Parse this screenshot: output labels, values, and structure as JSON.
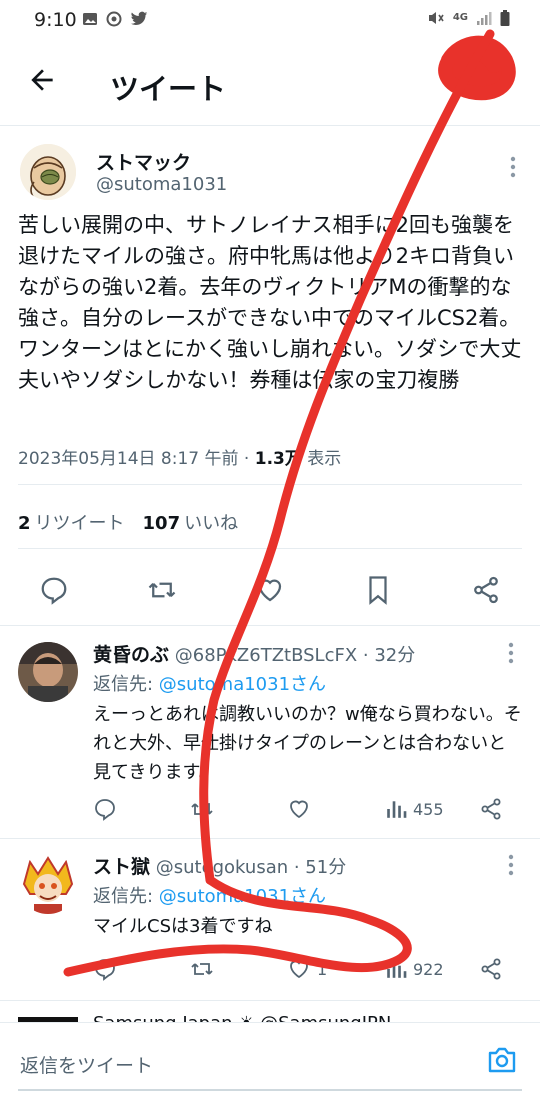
{
  "status_bar": {
    "time": "9:10",
    "network": "4G"
  },
  "header": {
    "title": "ツイート"
  },
  "main_tweet": {
    "author_name": "ストマック",
    "author_handle": "@sutoma1031",
    "text": "苦しい展開の中、サトノレイナス相手に2回も強襲を退けたマイルの強さ。府中牝馬は他より2キロ背負いながらの強い2着。去年のヴィクトリアMの衝撃的な強さ。自分のレースができない中でのマイルCS2着。ワンターンはとにかく強いし崩れない。ソダシで大丈夫いやソダシしかない！券種は伝家の宝刀複勝",
    "meta_datetime": "2023年05月14日 8:17 午前 · ",
    "meta_views_count": "1.3万",
    "meta_views_label": " 表示",
    "retweet_count": "2",
    "retweet_label": "リツイート",
    "like_count": "107",
    "like_label": "いいね"
  },
  "replies": [
    {
      "name": "黄昏のぶ",
      "handle": "@68PkZ6TZtBSLcFX",
      "time": " · 32分",
      "reply_to_label": "返信先: ",
      "reply_to_handle": "@sutoma1031さん",
      "text": "えーっとあれは調教いいのか？w俺なら買わない。それと大外、早仕掛けタイプのレーンとは合わないと見てきります。",
      "like_count": "",
      "views": "455"
    },
    {
      "name": "スト獄",
      "handle": "@sutogokusan",
      "time": " · 51分",
      "reply_to_label": "返信先: ",
      "reply_to_handle": "@sutoma1031さん",
      "text": "マイルCSは3着ですね",
      "like_count": "1",
      "views": "922"
    }
  ],
  "peek": {
    "text": "Samsung Japan ☀ @SamsungJPN"
  },
  "compose": {
    "placeholder": "返信をツイート"
  },
  "colors": {
    "accent": "#1d9bf0",
    "scribble": "#e8322b",
    "muted": "#536471"
  },
  "icons": [
    "back-arrow-icon",
    "more-vert-icon",
    "reply-icon",
    "retweet-icon",
    "like-icon",
    "bookmark-icon",
    "share-icon",
    "views-icon",
    "camera-icon"
  ]
}
